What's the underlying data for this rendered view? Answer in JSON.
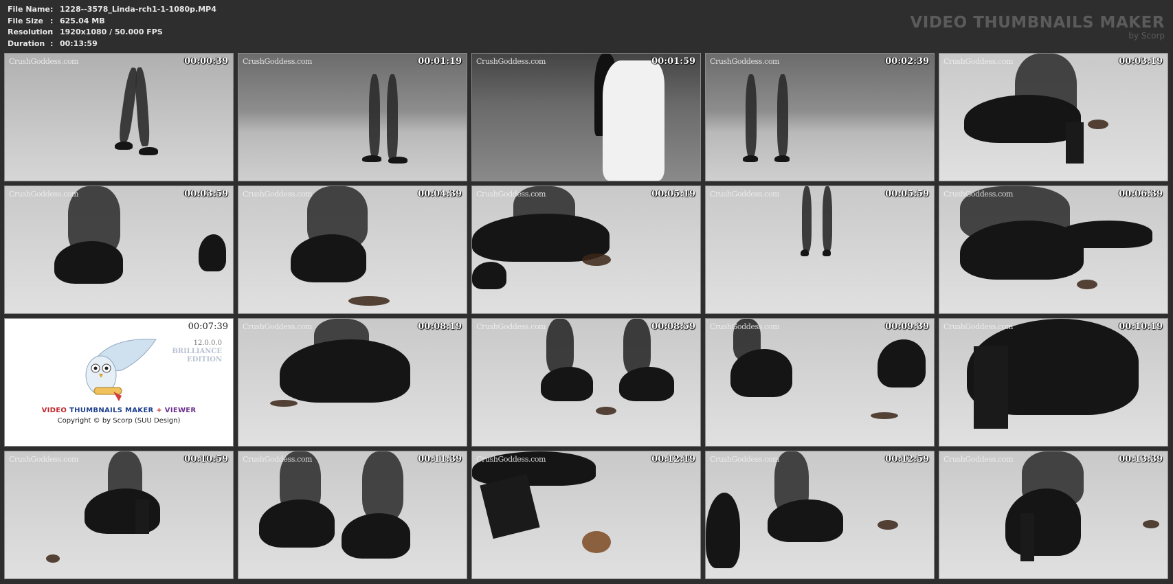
{
  "file_info": [
    {
      "key": "File Name",
      "value": "1228--3578_Linda-rch1-1-1080p.MP4"
    },
    {
      "key": "File Size",
      "value": "625.04 MB"
    },
    {
      "key": "Resolution",
      "value": "1920x1080 / 50.000 FPS"
    },
    {
      "key": "Duration",
      "value": "00:13:59"
    }
  ],
  "separator": ":",
  "brand": {
    "title": "VIDEO THUMBNAILS MAKER",
    "subtitle": "by Scorp"
  },
  "watermark": "CrushGoddess.com",
  "thumbnails": [
    {
      "time": "00:00:39"
    },
    {
      "time": "00:01:19"
    },
    {
      "time": "00:01:59"
    },
    {
      "time": "00:02:39"
    },
    {
      "time": "00:03:19"
    },
    {
      "time": "00:03:59"
    },
    {
      "time": "00:04:39"
    },
    {
      "time": "00:05:19"
    },
    {
      "time": "00:05:59"
    },
    {
      "time": "00:06:39"
    },
    {
      "time": "00:07:39"
    },
    {
      "time": "00:08:19"
    },
    {
      "time": "00:08:59"
    },
    {
      "time": "00:09:39"
    },
    {
      "time": "00:10:19"
    },
    {
      "time": "00:10:59"
    },
    {
      "time": "00:11:39"
    },
    {
      "time": "00:12:19"
    },
    {
      "time": "00:12:59"
    },
    {
      "time": "00:13:39"
    }
  ],
  "logo_tile": {
    "version": "12.0.0.0",
    "edition_line1": "BRILLIANCE",
    "edition_line2": "EDITION",
    "name_part1": "VIDEO",
    "name_part2": "THUMBNAILS MAKER",
    "name_part3": "+",
    "name_part4": "VIEWER",
    "copyright": "Copyright © by Scorp (SUU Design)"
  }
}
